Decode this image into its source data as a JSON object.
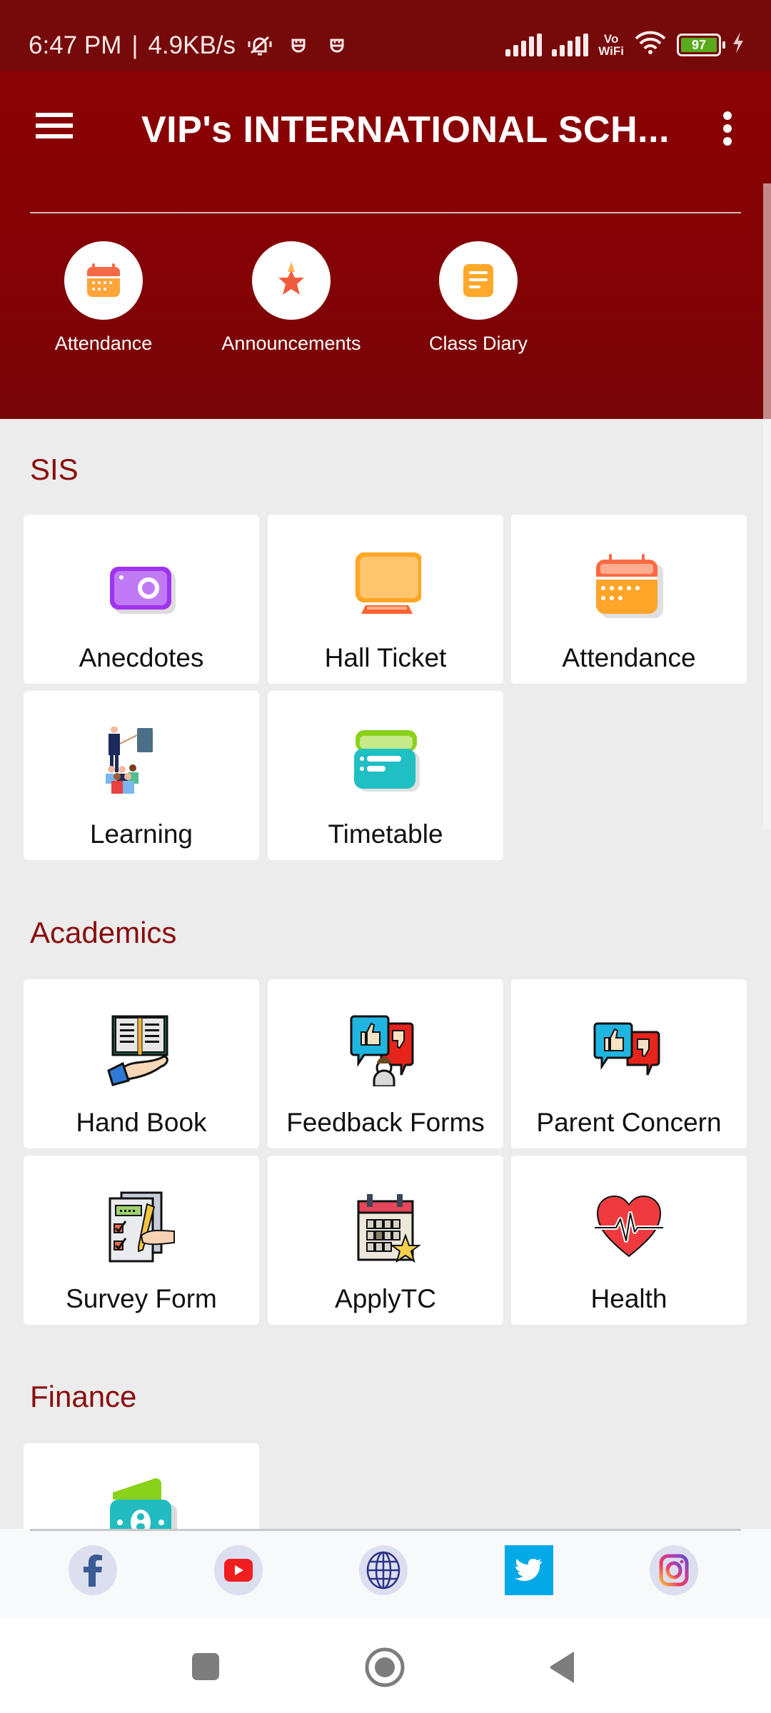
{
  "status_bar": {
    "time": "6:47 PM",
    "separator": "|",
    "network_speed": "4.9KB/s",
    "icons": [
      "bell-off-icon",
      "app-notification-icon",
      "app-notification-icon",
      "signal-icon",
      "signal-icon",
      "vowifi-icon",
      "wifi-icon",
      "battery-icon",
      "charging-icon"
    ],
    "vowifi_top": "Vo",
    "vowifi_bottom": "WiFi",
    "battery_level": "97",
    "battery_color": "#5aaa1e"
  },
  "app_bar": {
    "title": "VIP's INTERNATIONAL SCH...",
    "menu_icon": "hamburger-icon",
    "overflow_icon": "more-vert-icon",
    "background": "#8a0204"
  },
  "quick_links": [
    {
      "label": "Attendance",
      "icon": "calendar-icon"
    },
    {
      "label": "Announcements",
      "icon": "star-icon"
    },
    {
      "label": "Class Diary",
      "icon": "notes-icon"
    }
  ],
  "sections": [
    {
      "title": "SIS",
      "items": [
        {
          "label": "Anecdotes",
          "icon": "camera-icon"
        },
        {
          "label": "Hall Ticket",
          "icon": "monitor-icon"
        },
        {
          "label": "Attendance",
          "icon": "calendar-icon"
        },
        {
          "label": "Learning",
          "icon": "teacher-class-icon"
        },
        {
          "label": "Timetable",
          "icon": "timetable-icon"
        }
      ]
    },
    {
      "title": "Academics",
      "items": [
        {
          "label": "Hand Book",
          "icon": "handbook-icon"
        },
        {
          "label": "Feedback Forms",
          "icon": "feedback-icon"
        },
        {
          "label": "Parent Concern",
          "icon": "thumbs-chat-icon"
        },
        {
          "label": "Survey Form",
          "icon": "survey-icon"
        },
        {
          "label": "ApplyTC",
          "icon": "calendar-star-icon"
        },
        {
          "label": "Health",
          "icon": "heartbeat-icon"
        }
      ]
    },
    {
      "title": "Finance",
      "items": [
        {
          "label": "",
          "icon": "money-icon"
        }
      ]
    }
  ],
  "social": [
    {
      "name": "Facebook",
      "icon": "facebook-icon"
    },
    {
      "name": "YouTube",
      "icon": "youtube-icon"
    },
    {
      "name": "Website",
      "icon": "globe-icon"
    },
    {
      "name": "Twitter",
      "icon": "twitter-icon"
    },
    {
      "name": "Instagram",
      "icon": "instagram-icon"
    }
  ],
  "colors": {
    "primary": "#8a0204",
    "section_title": "#8a0b0d",
    "background": "#ececec",
    "twitter": "#03a9e6"
  }
}
